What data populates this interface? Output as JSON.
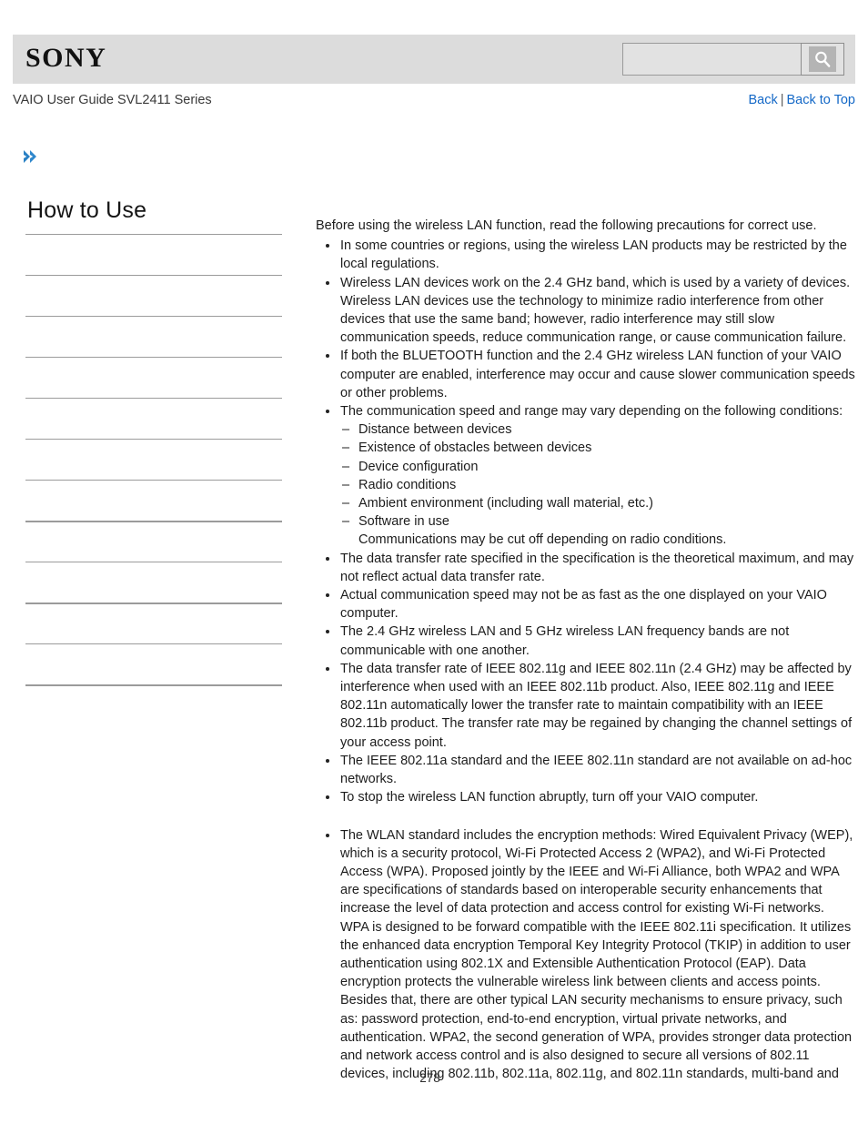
{
  "header": {
    "logo": "SONY",
    "search": {
      "value": "",
      "placeholder": "",
      "icon": "magnifier-icon"
    }
  },
  "subheader": {
    "guide_title": "VAIO User Guide SVL2411 Series",
    "links": {
      "back": "Back",
      "separator": "|",
      "back_to_top": "Back to Top"
    }
  },
  "breadcrumb_marker": {
    "icon": "double-chevron-right-icon",
    "color": "#2980c4"
  },
  "sidebar": {
    "title": "How to Use",
    "items": [
      {
        "label": "",
        "rule": "thin"
      },
      {
        "label": "",
        "rule": "thin"
      },
      {
        "label": "",
        "rule": "thin"
      },
      {
        "label": "",
        "rule": "thin"
      },
      {
        "label": "",
        "rule": "thin"
      },
      {
        "label": "",
        "rule": "thin"
      },
      {
        "label": "",
        "rule": "thin"
      },
      {
        "label": "",
        "rule": "thick"
      },
      {
        "label": "",
        "rule": "thin"
      },
      {
        "label": "",
        "rule": "thick"
      },
      {
        "label": "",
        "rule": "thin"
      },
      {
        "label": "",
        "rule": "thick"
      }
    ]
  },
  "content": {
    "intro": "Before using the wireless LAN function, read the following precautions for correct use.",
    "bullets_group_1": [
      "In some countries or regions, using the wireless LAN products may be restricted by the local regulations.",
      "Wireless LAN devices work on the 2.4 GHz band, which is used by a variety of devices. Wireless LAN devices use the technology to minimize radio interference from other devices that use the same band; however, radio interference may still slow communication speeds, reduce communication range, or cause communication failure.",
      "If both the BLUETOOTH function and the 2.4 GHz wireless LAN function of your VAIO computer are enabled, interference may occur and cause slower communication speeds or other problems."
    ],
    "conditions_bullet": "The communication speed and range may vary depending on the following conditions:",
    "conditions": [
      "Distance between devices",
      "Existence of obstacles between devices",
      "Device configuration",
      "Radio conditions",
      "Ambient environment (including wall material, etc.)",
      "Software in use"
    ],
    "conditions_note": "Communications may be cut off depending on radio conditions.",
    "bullets_group_2": [
      "The data transfer rate specified in the specification is the theoretical maximum, and may not reflect actual data transfer rate.",
      "Actual communication speed may not be as fast as the one displayed on your VAIO computer.",
      "The 2.4 GHz wireless LAN and 5 GHz wireless LAN frequency bands are not communicable with one another.",
      "The data transfer rate of IEEE 802.11g and IEEE 802.11n (2.4 GHz) may be affected by interference when used with an IEEE 802.11b product. Also, IEEE 802.11g and IEEE 802.11n automatically lower the transfer rate to maintain compatibility with an IEEE 802.11b product. The transfer rate may be regained by changing the channel settings of your access point.",
      "The IEEE 802.11a standard and the IEEE 802.11n standard are not available on ad-hoc networks.",
      "To stop the wireless LAN function abruptly, turn off your VAIO computer."
    ],
    "bullets_group_3": [
      "The WLAN standard includes the encryption methods: Wired Equivalent Privacy (WEP), which is a security protocol, Wi-Fi Protected Access 2 (WPA2), and Wi-Fi Protected Access (WPA). Proposed jointly by the IEEE and Wi-Fi Alliance, both WPA2 and WPA are specifications of standards based on interoperable security enhancements that increase the level of data protection and access control for existing Wi-Fi networks. WPA is designed to be forward compatible with the IEEE 802.11i specification. It utilizes the enhanced data encryption Temporal Key Integrity Protocol (TKIP) in addition to user authentication using 802.1X and Extensible Authentication Protocol (EAP). Data encryption protects the vulnerable wireless link between clients and access points. Besides that, there are other typical LAN security mechanisms to ensure privacy, such as: password protection, end-to-end encryption, virtual private networks, and authentication. WPA2, the second generation of WPA, provides stronger data protection and network access control and is also designed to secure all versions of 802.11 devices, including 802.11b, 802.11a, 802.11g, and 802.11n standards, multi-band and"
    ]
  },
  "footer": {
    "page_number": "278"
  },
  "colors": {
    "header_band": "#dcdcdc",
    "link": "#1569c7",
    "chevron": "#2980c4",
    "rule": "#9b9b9b"
  }
}
